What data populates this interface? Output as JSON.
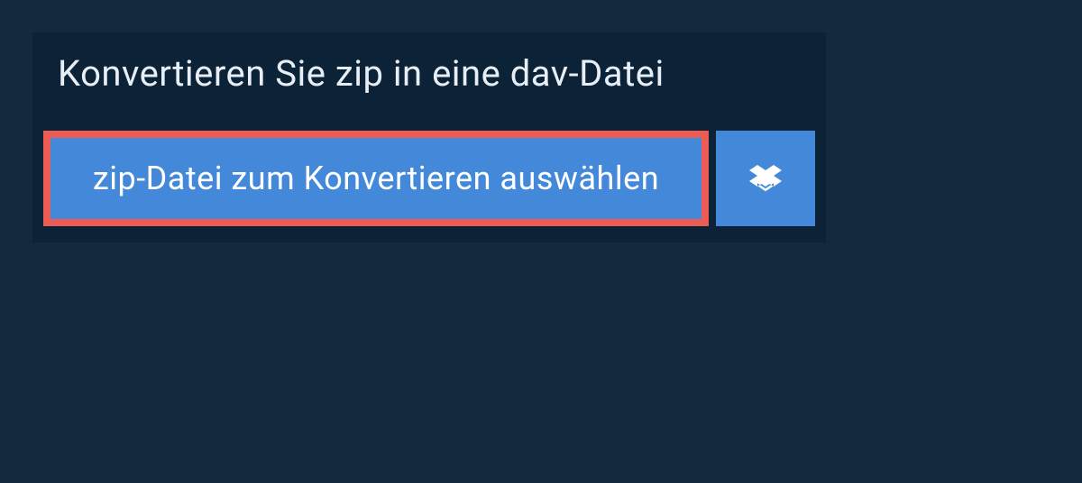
{
  "header": {
    "title": "Konvertieren Sie zip in eine dav-Datei"
  },
  "buttons": {
    "choose_file_label": "zip-Datei zum Konvertieren auswählen"
  },
  "colors": {
    "page_bg": "#14293e",
    "panel_bg": "#0c2236",
    "button_bg": "#4489d9",
    "highlight_border": "#ea5c54",
    "text_light": "#ffffff"
  }
}
